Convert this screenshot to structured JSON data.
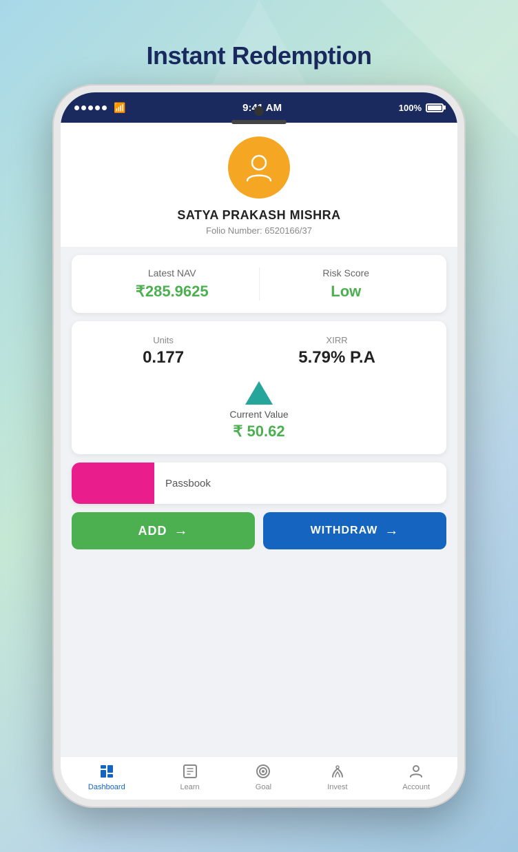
{
  "page": {
    "title": "Instant Redemption"
  },
  "status_bar": {
    "dots": 5,
    "time": "9:41 AM",
    "battery": "100%"
  },
  "user": {
    "name": "SATYA PRAKASH MISHRA",
    "folio_label": "Folio Number:",
    "folio_number": "6520166/37"
  },
  "nav_label": {
    "label": "Latest NAV",
    "value": "₹285.9625",
    "risk_label": "Risk Score",
    "risk_value": "Low"
  },
  "metrics": {
    "units_label": "Units",
    "units_value": "0.177",
    "xirr_label": "XIRR",
    "xirr_value": "5.79% P.A",
    "current_value_label": "Current Value",
    "current_value": "₹ 50.62"
  },
  "passbook": {
    "tab_label": "Passbook"
  },
  "buttons": {
    "add_label": "ADD",
    "withdraw_label": "WITHDRAW",
    "arrow": "→"
  },
  "bottom_nav": {
    "items": [
      {
        "label": "Dashboard",
        "icon": "dashboard-icon",
        "active": true
      },
      {
        "label": "Learn",
        "icon": "learn-icon",
        "active": false
      },
      {
        "label": "Goal",
        "icon": "goal-icon",
        "active": false
      },
      {
        "label": "Invest",
        "icon": "invest-icon",
        "active": false
      },
      {
        "label": "Account",
        "icon": "account-icon",
        "active": false
      }
    ]
  }
}
